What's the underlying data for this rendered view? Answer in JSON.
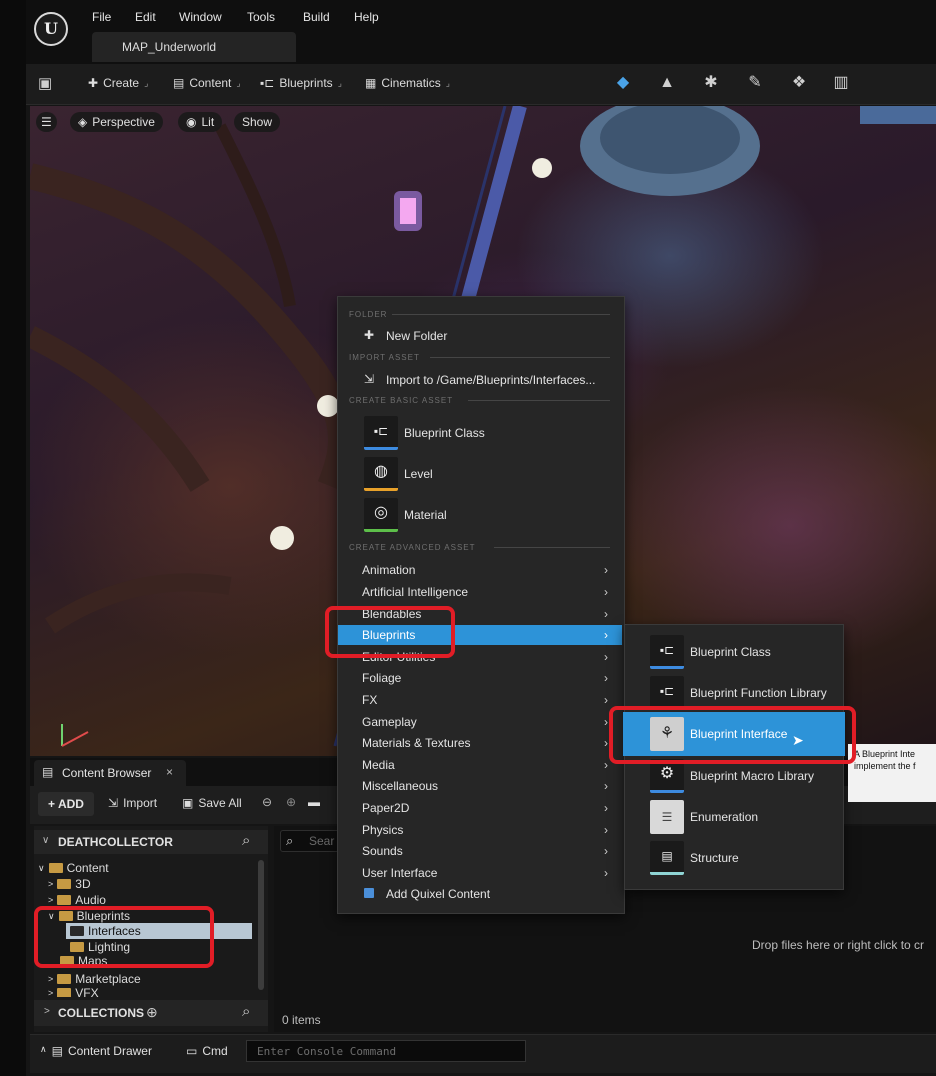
{
  "menubar": {
    "logo": "U",
    "items": [
      "File",
      "Edit",
      "Window",
      "Tools",
      "Build",
      "Help"
    ],
    "level_tab": "MAP_Underworld"
  },
  "toolbar": {
    "create": "Create",
    "content": "Content",
    "blueprints": "Blueprints",
    "cinematics": "Cinematics"
  },
  "viewport": {
    "perspective": "Perspective",
    "lit": "Lit",
    "show": "Show"
  },
  "context_menu": {
    "sections": {
      "folder": "FOLDER",
      "import": "IMPORT ASSET",
      "basic": "CREATE BASIC ASSET",
      "advanced": "CREATE ADVANCED ASSET"
    },
    "new_folder": "New Folder",
    "import_to": "Import to /Game/Blueprints/Interfaces...",
    "basic_assets": [
      "Blueprint Class",
      "Level",
      "Material"
    ],
    "advanced": [
      "Animation",
      "Artificial Intelligence",
      "Blendables",
      "Blueprints",
      "Editor Utilities",
      "Foliage",
      "FX",
      "Gameplay",
      "Materials & Textures",
      "Media",
      "Miscellaneous",
      "Paper2D",
      "Physics",
      "Sounds",
      "User Interface"
    ],
    "quixel": "Add Quixel Content"
  },
  "submenu": {
    "items": [
      "Blueprint Class",
      "Blueprint Function Library",
      "Blueprint Interface",
      "Blueprint Macro Library",
      "Enumeration",
      "Structure"
    ]
  },
  "tooltip": {
    "text": "A Blueprint Inte implement the f"
  },
  "content_browser": {
    "tab": "Content Browser",
    "add": "+ ADD",
    "import": "Import",
    "save_all": "Save All",
    "project": "DEATHCOLLECTOR",
    "search_placeholder": "Sear",
    "tree": [
      "Content",
      "3D",
      "Audio",
      "Blueprints",
      "Interfaces",
      "Lighting",
      "Maps",
      "Marketplace",
      "VFX"
    ],
    "collections": "COLLECTIONS",
    "empty_hint": "Drop files here or right click to cr",
    "items_count": "0 items"
  },
  "bottom": {
    "drawer": "Content Drawer",
    "cmd": "Cmd",
    "console_placeholder": "Enter Console Command"
  },
  "colors": {
    "highlight": "#2d93d8",
    "annotation": "#e11d26"
  }
}
